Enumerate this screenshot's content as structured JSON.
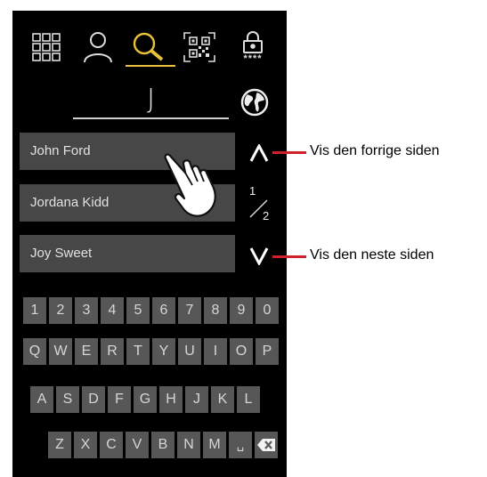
{
  "toolbar": {
    "icons": [
      "grid-icon",
      "person-icon",
      "search-icon",
      "qr-code-icon",
      "lock-icon"
    ],
    "lock_code": "****",
    "accent_color": "#e8c33a"
  },
  "search": {
    "query": "J"
  },
  "results": [
    {
      "name": "John Ford"
    },
    {
      "name": "Jordana Kidd"
    },
    {
      "name": "Joy Sweet"
    }
  ],
  "pager": {
    "current": "1",
    "total": "2"
  },
  "keyboard": {
    "row1": [
      "1",
      "2",
      "3",
      "4",
      "5",
      "6",
      "7",
      "8",
      "9",
      "0"
    ],
    "row2": [
      "Q",
      "W",
      "E",
      "R",
      "T",
      "Y",
      "U",
      "I",
      "O",
      "P"
    ],
    "row3": [
      "A",
      "S",
      "D",
      "F",
      "G",
      "H",
      "J",
      "K",
      "L"
    ],
    "row4": [
      "Z",
      "X",
      "C",
      "V",
      "B",
      "N",
      "M"
    ],
    "space_label": "␣"
  },
  "annotations": {
    "prev": "Vis den forrige siden",
    "next": "Vis den neste siden",
    "color": "#d0202a"
  }
}
